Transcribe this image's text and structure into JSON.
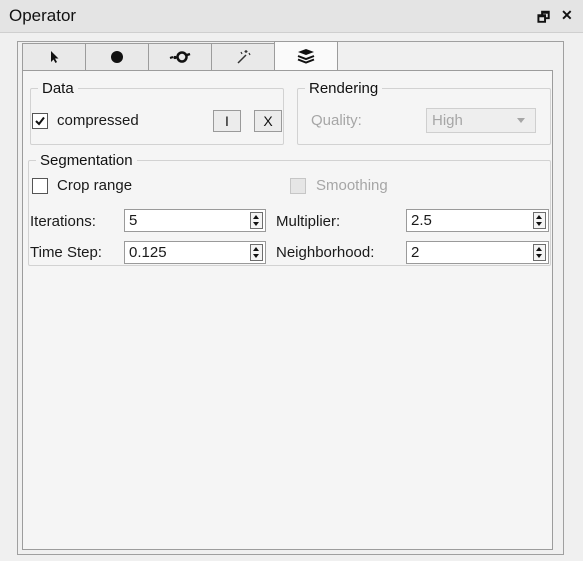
{
  "window": {
    "title": "Operator",
    "float_icon": "float-icon",
    "close_icon": "close-icon",
    "float_glyph": "🗗",
    "close_glyph": "✕"
  },
  "tabs": [
    {
      "icon": "pointer-icon"
    },
    {
      "icon": "dot-icon"
    },
    {
      "icon": "brush-stroke-icon"
    },
    {
      "icon": "magic-wand-icon"
    },
    {
      "icon": "layers-icon",
      "active": true
    }
  ],
  "data_group": {
    "title": "Data",
    "compressed_label": "compressed",
    "compressed_checked": true,
    "info_button": "I",
    "clear_button": "X"
  },
  "rendering_group": {
    "title": "Rendering",
    "quality_label": "Quality:",
    "quality_value": "High"
  },
  "segmentation_group": {
    "title": "Segmentation",
    "crop_range_label": "Crop range",
    "crop_range_checked": false,
    "smoothing_label": "Smoothing",
    "smoothing_checked": false,
    "iterations_label": "Iterations:",
    "iterations_value": "5",
    "multiplier_label": "Multiplier:",
    "multiplier_value": "2.5",
    "timestep_label": "Time Step:",
    "timestep_value": "0.125",
    "neighborhood_label": "Neighborhood:",
    "neighborhood_value": "2"
  },
  "colors": {
    "background": "#f0f0f0",
    "disabled_text": "#a6a6a6"
  }
}
